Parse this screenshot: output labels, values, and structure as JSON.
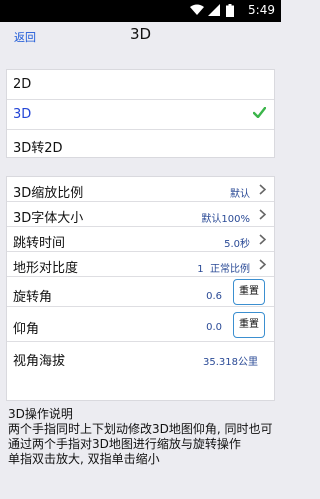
{
  "status_bar": {
    "time": "5:49"
  },
  "header": {
    "back_label": "返回",
    "title": "3D"
  },
  "mode_options": [
    {
      "label": "2D",
      "selected": false
    },
    {
      "label": "3D",
      "selected": true
    },
    {
      "label": "3D转2D",
      "selected": false
    }
  ],
  "settings": [
    {
      "label": "3D缩放比例",
      "value": "默认"
    },
    {
      "label": "3D字体大小",
      "value": "默认100%"
    },
    {
      "label": "跳转时间",
      "value": "5.0秒"
    },
    {
      "label": "地形对比度",
      "value": "1  正常比例"
    },
    {
      "label": "旋转角",
      "value": "0.6",
      "button": "重置"
    },
    {
      "label": "仰角",
      "value": "0.0",
      "button": "重置"
    },
    {
      "label": "视角海拔",
      "value": "35.318公里"
    }
  ],
  "instructions": {
    "title": "3D操作说明",
    "line1": "两个手指同时上下划动修改3D地图仰角, 同时也可通过两个手指对3D地图进行缩放与旋转操作",
    "line2": "单指双击放大, 双指单击缩小"
  },
  "colors": {
    "accent": "#2244d6",
    "check": "#3bb54a",
    "value_text": "#2a4a96",
    "button_border": "#3b8fd0"
  }
}
